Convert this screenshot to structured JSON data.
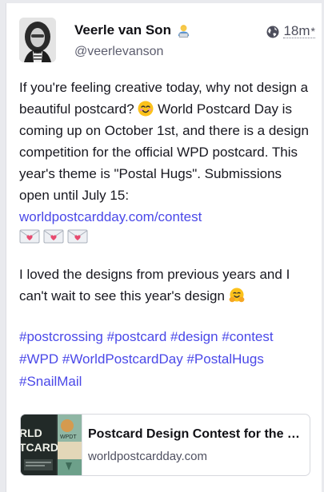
{
  "post": {
    "author": {
      "display_name": "Veerle van Son",
      "name_emoji": "technologist-emoji",
      "handle": "@veerlevanson"
    },
    "visibility_icon": "globe-icon",
    "timestamp": "18m",
    "edited_marker": "*",
    "paragraph1_before_emoji": "If you're feeling creative today, why not design a beautiful postcard? ",
    "paragraph1_after_emoji": " World Postcard Day is coming up on October 1st, and there is a design competition for the official WPD postcard. This year's theme is \"Postal Hugs\". Submissions open until July 15: ",
    "contest_link": "worldpostcardday.com/contest",
    "paragraph2": "I loved the designs from previous years and I can't wait to see this year's design ",
    "hashtags": [
      "#postcrossing",
      "#postcard",
      "#design",
      "#contest",
      "#WPD",
      "#WorldPostcardDay",
      "#PostalHugs",
      "#SnailMail"
    ]
  },
  "link_preview": {
    "title": "Postcard Design Contest for the official WPD postcard",
    "domain": "worldpostcardday.com",
    "thumb_text_1": "RLD",
    "thumb_text_2": "TCARD",
    "thumb_text_3": "WPDT"
  },
  "colors": {
    "link": "#4a48e8",
    "text": "#17171f",
    "muted": "#5c5d6e"
  }
}
